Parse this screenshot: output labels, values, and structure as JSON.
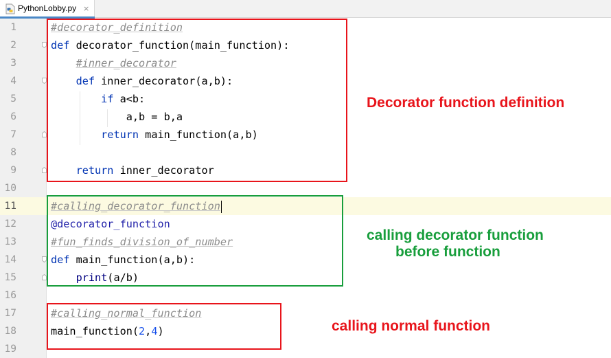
{
  "tab": {
    "filename": "PythonLobby.py",
    "close_glyph": "×",
    "icon": "python-file-icon"
  },
  "editor": {
    "current_line": 11,
    "lines": [
      {
        "n": "1",
        "segments": [
          {
            "t": "#decorator_definition",
            "c": "cm"
          }
        ]
      },
      {
        "n": "2",
        "segments": [
          {
            "t": "def",
            "c": "kw"
          },
          {
            "t": " decorator_function(main_function):",
            "c": ""
          }
        ]
      },
      {
        "n": "3",
        "segments": [
          {
            "t": "    ",
            "c": ""
          },
          {
            "t": "#inner_decorator",
            "c": "cm"
          }
        ]
      },
      {
        "n": "4",
        "segments": [
          {
            "t": "    ",
            "c": ""
          },
          {
            "t": "def",
            "c": "kw"
          },
          {
            "t": " inner_decorator(a,b):",
            "c": ""
          }
        ]
      },
      {
        "n": "5",
        "segments": [
          {
            "t": "        ",
            "c": ""
          },
          {
            "t": "if",
            "c": "kw"
          },
          {
            "t": " a<b:",
            "c": ""
          }
        ]
      },
      {
        "n": "6",
        "segments": [
          {
            "t": "            a,b = b,a",
            "c": ""
          }
        ]
      },
      {
        "n": "7",
        "segments": [
          {
            "t": "        ",
            "c": ""
          },
          {
            "t": "return",
            "c": "kw"
          },
          {
            "t": " main_function(a,b)",
            "c": ""
          }
        ]
      },
      {
        "n": "8",
        "segments": []
      },
      {
        "n": "9",
        "segments": [
          {
            "t": "    ",
            "c": ""
          },
          {
            "t": "return",
            "c": "kw"
          },
          {
            "t": " inner_decorator",
            "c": ""
          }
        ]
      },
      {
        "n": "10",
        "segments": []
      },
      {
        "n": "11",
        "segments": [
          {
            "t": "#calling_decorator_function",
            "c": "cm"
          }
        ]
      },
      {
        "n": "12",
        "segments": [
          {
            "t": "@decorator_function",
            "c": "dec"
          }
        ]
      },
      {
        "n": "13",
        "segments": [
          {
            "t": "#fun_finds_division_of_number",
            "c": "cm"
          }
        ]
      },
      {
        "n": "14",
        "segments": [
          {
            "t": "def",
            "c": "kw"
          },
          {
            "t": " main_function(a,b):",
            "c": ""
          }
        ]
      },
      {
        "n": "15",
        "segments": [
          {
            "t": "    ",
            "c": ""
          },
          {
            "t": "print",
            "c": "bi"
          },
          {
            "t": "(a/b)",
            "c": ""
          }
        ]
      },
      {
        "n": "16",
        "segments": []
      },
      {
        "n": "17",
        "segments": [
          {
            "t": "#calling_normal_function",
            "c": "cm"
          }
        ]
      },
      {
        "n": "18",
        "segments": [
          {
            "t": "main_function(",
            "c": ""
          },
          {
            "t": "2",
            "c": "num"
          },
          {
            "t": ",",
            "c": ""
          },
          {
            "t": "4",
            "c": "num"
          },
          {
            "t": ")",
            "c": ""
          }
        ]
      },
      {
        "n": "19",
        "segments": []
      }
    ]
  },
  "annotations": {
    "decorator_definition": {
      "text": "Decorator function definition",
      "color": "#e8141b"
    },
    "calling_decorator_line1": {
      "text": "calling decorator function",
      "color": "#189e3c"
    },
    "calling_decorator_line2": {
      "text": "before function",
      "color": "#189e3c"
    },
    "calling_normal": {
      "text": "calling normal function",
      "color": "#e8141b"
    }
  },
  "colors": {
    "red_box": "#e8141b",
    "green_box": "#189e3c",
    "current_line_bg": "#fcfae1",
    "keyword": "#0033b3",
    "comment": "#8c8c8c"
  }
}
